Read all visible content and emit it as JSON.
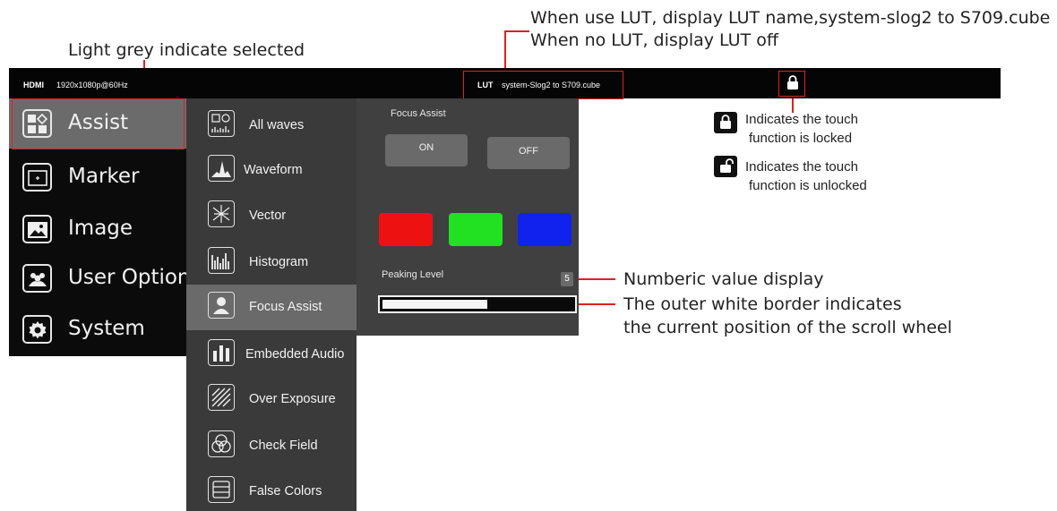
{
  "annotations": {
    "lut_note_line1": "When use LUT, display LUT name,system-slog2 to S709.cube",
    "lut_note_line2": "When no LUT, display LUT off",
    "selected_note": "Light grey indicate selected",
    "locked_line1": "Indicates the touch",
    "locked_line2": "function is locked",
    "unlocked_line1": "Indicates the touch",
    "unlocked_line2": "function is unlocked",
    "value_note": "Numberic value display",
    "wheel_note_line1": "The outer white border indicates",
    "wheel_note_line2": "the current position of the scroll wheel",
    "accent_color": "#e02020"
  },
  "status_bar": {
    "input_label": "HDMI",
    "resolution": "1920x1080p@60Hz",
    "lut_label": "LUT",
    "lut_name": "system-Slog2  to S709.cube",
    "lock_icon": "lock-icon"
  },
  "main_menu": {
    "items": [
      {
        "label": "Assist",
        "icon": "assist-icon",
        "selected": true
      },
      {
        "label": "Marker",
        "icon": "marker-icon",
        "selected": false
      },
      {
        "label": "Image",
        "icon": "image-icon",
        "selected": false
      },
      {
        "label": "User Option",
        "icon": "user-option-icon",
        "selected": false
      },
      {
        "label": "System",
        "icon": "gear-icon",
        "selected": false
      }
    ]
  },
  "sub_menu": {
    "items": [
      {
        "label": "All waves",
        "icon": "all-waves-icon",
        "selected": false
      },
      {
        "label": "Waveform",
        "icon": "waveform-icon",
        "selected": false
      },
      {
        "label": "Vector",
        "icon": "vector-icon",
        "selected": false
      },
      {
        "label": "Histogram",
        "icon": "histogram-icon",
        "selected": false
      },
      {
        "label": "Focus Assist",
        "icon": "focus-assist-icon",
        "selected": true
      },
      {
        "label": "Embedded Audio",
        "icon": "audio-icon",
        "selected": false
      },
      {
        "label": "Over Exposure",
        "icon": "over-exposure-icon",
        "selected": false
      },
      {
        "label": "Check Field",
        "icon": "check-field-icon",
        "selected": false
      },
      {
        "label": "False Colors",
        "icon": "false-colors-icon",
        "selected": false
      }
    ]
  },
  "panel": {
    "title": "Focus Assist",
    "on_label": "ON",
    "off_label": "OFF",
    "color_options": [
      "#ee1111",
      "#22e022",
      "#1122ee"
    ],
    "peaking_label": "Peaking Level",
    "peaking_value": "5",
    "peaking_fraction": 0.55
  }
}
